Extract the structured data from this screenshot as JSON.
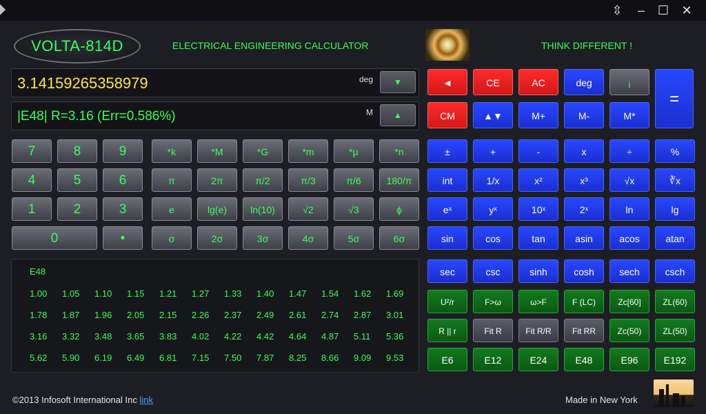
{
  "titlebar": {
    "restore_icon": "⇳",
    "min_icon": "–",
    "max_icon": "☐",
    "close_icon": "✕"
  },
  "header": {
    "logo": "VOLTA-814D",
    "subtitle": "ELECTRICAL ENGINEERING CALCULATOR",
    "tagline": "THINK DIFFERENT !"
  },
  "display": {
    "main_value": "3.14159265358979",
    "main_mode": "deg",
    "main_btn": "▼",
    "secondary_value": "|E48| R=3.16 (Err=0.586%)",
    "secondary_mode": "M",
    "secondary_btn": "▲"
  },
  "left_keys": [
    [
      "7",
      "8",
      "9"
    ],
    [
      "4",
      "5",
      "6"
    ],
    [
      "1",
      "2",
      "3"
    ]
  ],
  "zero_key": "0",
  "dot_key": "•",
  "const_keys": [
    [
      "*k",
      "*M",
      "*G",
      "*m",
      "*µ",
      "*n"
    ],
    [
      "π",
      "2π",
      "π/2",
      "π/3",
      "π/6",
      "180/π"
    ],
    [
      "e",
      "lg(e)",
      "ln(10)",
      "√2",
      "√3",
      "ϕ"
    ],
    [
      "σ",
      "2σ",
      "3σ",
      "4σ",
      "5σ",
      "6σ"
    ]
  ],
  "right_top": {
    "row1": [
      "◄",
      "CE",
      "AC",
      "deg",
      "¡"
    ],
    "row2": [
      "CM",
      "▲▼",
      "M+",
      "M-",
      "M*"
    ],
    "equals": "="
  },
  "right_func": [
    [
      "±",
      "+",
      "-",
      "x",
      "÷",
      "%"
    ],
    [
      "int",
      "1/x",
      "x²",
      "x³",
      "√x",
      "∛x"
    ],
    [
      "eˣ",
      "yˣ",
      "10ˣ",
      "2ˣ",
      "ln",
      "lg"
    ],
    [
      "sin",
      "cos",
      "tan",
      "asin",
      "acos",
      "atan"
    ],
    [
      "sec",
      "csc",
      "sinh",
      "cosh",
      "sech",
      "csch"
    ],
    [
      "U²/r",
      "F>ω",
      "ω>F",
      "F (LC)",
      "Zc[60]",
      "ZL(60)"
    ],
    [
      "R || r",
      "Fit R",
      "Fit R/R",
      "Fit RR",
      "Zc(50)",
      "ZL(50)"
    ],
    [
      "E6",
      "E12",
      "E24",
      "E48",
      "E96",
      "E192"
    ]
  ],
  "eseries": {
    "title": "E48",
    "rows": [
      [
        "1.00",
        "1.05",
        "1.10",
        "1.15",
        "1.21",
        "1.27",
        "1.33",
        "1.40",
        "1.47",
        "1.54",
        "1.62",
        "1.69"
      ],
      [
        "1.78",
        "1.87",
        "1.96",
        "2.05",
        "2.15",
        "2.26",
        "2.37",
        "2.49",
        "2.61",
        "2.74",
        "2.87",
        "3.01"
      ],
      [
        "3.16",
        "3.32",
        "3.48",
        "3.65",
        "3.83",
        "4.02",
        "4.22",
        "4.42",
        "4.64",
        "4.87",
        "5.11",
        "5.36"
      ],
      [
        "5.62",
        "5.90",
        "6.19",
        "6.49",
        "6.81",
        "7.15",
        "7.50",
        "7.87",
        "8.25",
        "8.66",
        "9.09",
        "9.53"
      ]
    ]
  },
  "footer": {
    "copyright": "©2013 Infosoft International Inc",
    "link": "link",
    "made_in": "Made in New York"
  },
  "colors": {
    "accent_green": "#39ff5a",
    "key_blue": "#2747ff",
    "key_red": "#ff2a2a",
    "key_green": "#127a1e"
  }
}
